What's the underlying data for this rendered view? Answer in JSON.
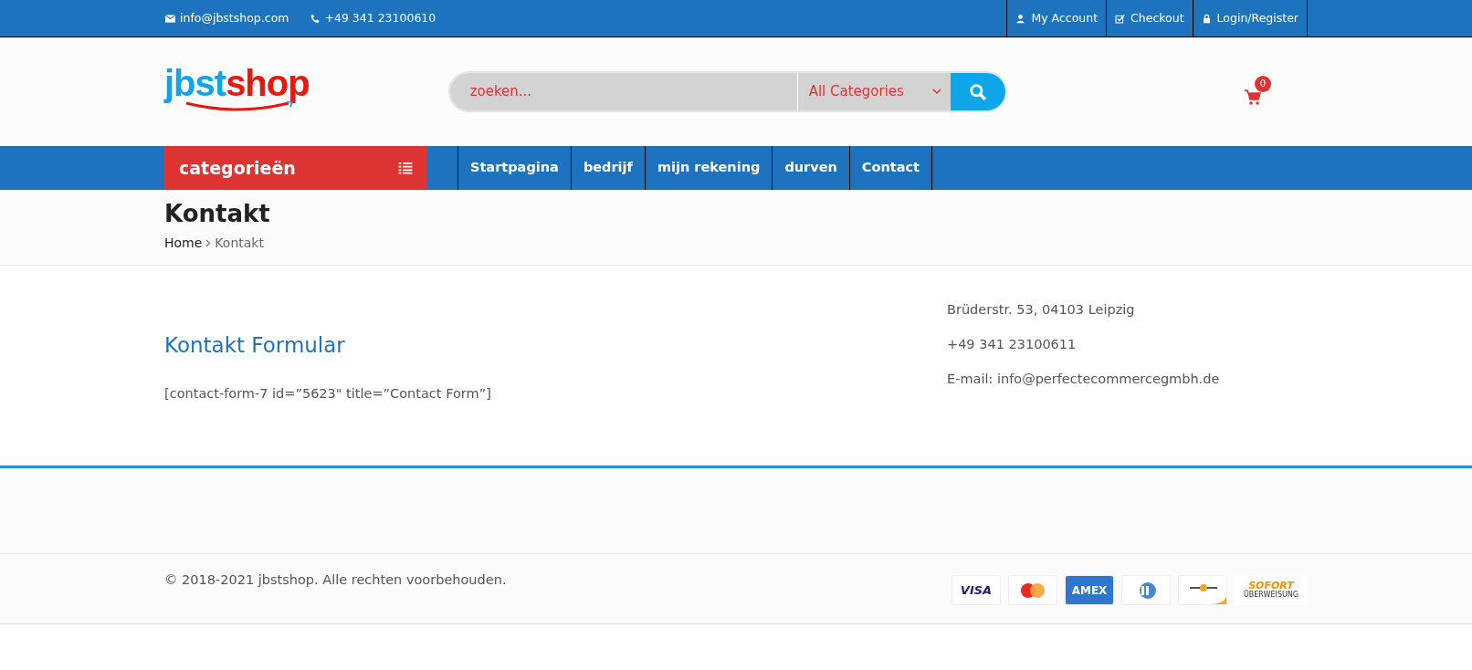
{
  "topbar": {
    "email": "info@jbstshop.com",
    "phone": "+49 341 23100610",
    "links": [
      {
        "kind": "user",
        "label": "My Account"
      },
      {
        "kind": "check",
        "label": "Checkout"
      },
      {
        "kind": "lock",
        "label": "Login/Register"
      }
    ]
  },
  "header": {
    "logo": {
      "part_1": "jbst",
      "part_2": "shop"
    },
    "search": {
      "placeholder": "zoeken...",
      "category": "All Categories"
    },
    "cart": {
      "count": "0"
    }
  },
  "nav": {
    "categories_label": "categorieën",
    "items": [
      {
        "label": "Startpagina"
      },
      {
        "label": "bedrijf"
      },
      {
        "label": "mijn rekening"
      },
      {
        "label": "durven"
      },
      {
        "label": "Contact"
      }
    ]
  },
  "page_title": "Kontakt",
  "breadcrumb": [
    {
      "label": "Home",
      "link": true
    },
    {
      "label": "Kontakt",
      "link": false
    }
  ],
  "form_section": {
    "heading": "Kontakt Formular",
    "shortcode": "[contact-form-7 id=”5623\" title=”Contact Form”]"
  },
  "address": [
    "Brüderstr. 53, 04103 Leipzig",
    "+49 341 23100611",
    "E-mail: info@perfectecommercegmbh.de"
  ],
  "footer": {
    "copyright": "© 2018-2021 jbstshop. Alle rechten voorbehouden.",
    "payments": [
      {
        "kind": "visa",
        "text": "VISA"
      },
      {
        "kind": "mastercard"
      },
      {
        "kind": "amex",
        "text": "AMEX"
      },
      {
        "kind": "diners"
      },
      {
        "kind": "generic"
      },
      {
        "kind": "sofort",
        "text": "SOFORT",
        "subtext": "ÜBERWEISUNG"
      }
    ]
  }
}
